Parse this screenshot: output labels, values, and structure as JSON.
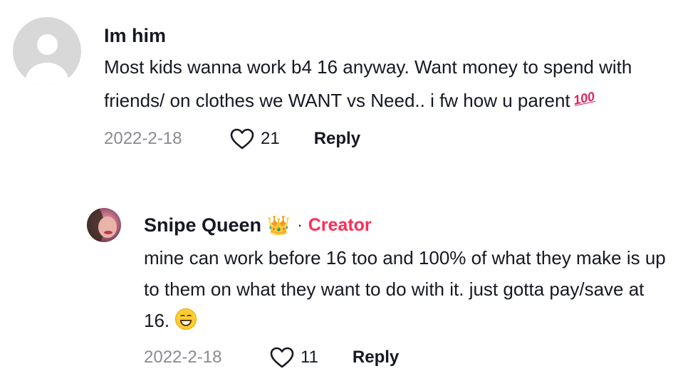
{
  "comments": [
    {
      "username": "Im him",
      "text": "Most kids wanna work b4 16 anyway. Want money to spend with friends/ on clothes we WANT vs Need.. i fw how u parent",
      "emoji": "💯",
      "date": "2022-2-18",
      "likes": "21",
      "reply_label": "Reply",
      "avatar_icon": "default-avatar-icon"
    }
  ],
  "replies": [
    {
      "username": "Snipe Queen",
      "username_emoji": "👑",
      "separator": "·",
      "badge": "Creator",
      "text": "mine can work before 16 too and 100% of what they make is up to them on what they want to do with it. just gotta pay/save at 16.",
      "emoji": "😁",
      "date": "2022-2-18",
      "likes": "11",
      "reply_label": "Reply",
      "avatar_icon": "profile-photo-avatar"
    }
  ],
  "colors": {
    "creator_badge": "#fe2c55",
    "date_text": "#8a8b91",
    "primary_text": "#161823"
  },
  "icons": {
    "like": "heart-outline-icon"
  }
}
